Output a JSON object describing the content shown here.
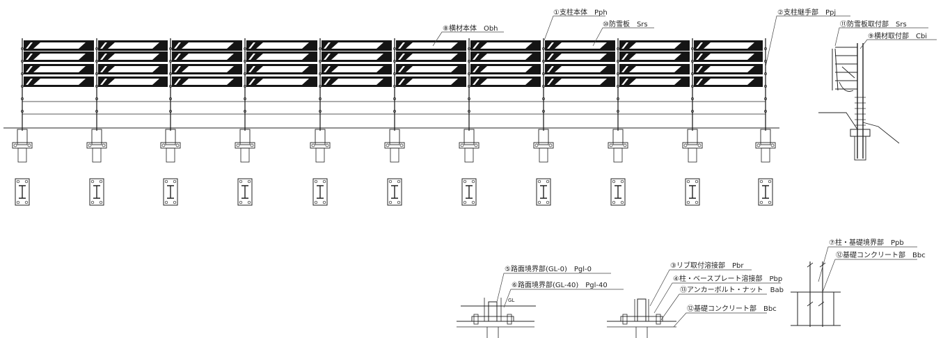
{
  "labels": {
    "l1": "①支柱本体　Pph",
    "l2": "②支柱継手部　Ppj",
    "l3": "③リブ取付溶接部　Pbr",
    "l4": "④柱・ベースプレート溶接部　Pbp",
    "l5": "⑤路面境界部(GL-0)　Pgl-0",
    "l6": "⑥路面境界部(GL-40)　Pgl-40",
    "l7": "⑦柱・基礎境界部　Ppb",
    "l8": "⑧横材本体　Obh",
    "l9": "⑨横材取付部　Cbi",
    "l10": "⑩防雪板　Srs",
    "l11": "⑪防雪板取付部　Srs",
    "l12a": "⑫基礎コンクリート部　Bbc",
    "l12b": "⑫基礎コンクリート部　Bbc",
    "l13": "⑬アンカーボルト・ナット　Bab",
    "gl": "GL"
  },
  "counts": {
    "spans": 10,
    "posts": 11,
    "panel_rows": 4
  },
  "colors": {
    "line": "#222222",
    "panel": "#151515",
    "background": "#ffffff"
  }
}
